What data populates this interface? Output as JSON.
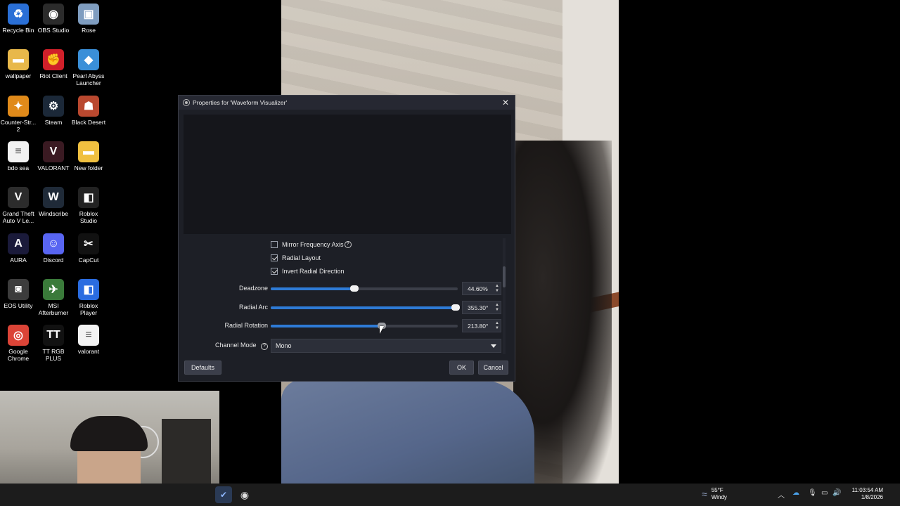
{
  "desktop": {
    "icons": [
      {
        "label": "Recycle Bin",
        "icon": "recycle-bin-icon",
        "color": "#2a6fd6",
        "glyph": "♻"
      },
      {
        "label": "OBS Studio",
        "icon": "obs-icon",
        "color": "#2b2b2b",
        "glyph": "◉"
      },
      {
        "label": "Rose",
        "icon": "image-icon",
        "color": "#7f9dc0",
        "glyph": "▣"
      },
      {
        "label": "wallpaper",
        "icon": "folder-icon",
        "color": "#e8b84a",
        "glyph": "▬"
      },
      {
        "label": "Riot Client",
        "icon": "riot-icon",
        "color": "#d0202a",
        "glyph": "✊"
      },
      {
        "label": "Pearl Abyss Launcher",
        "icon": "pearl-abyss-icon",
        "color": "#3a8fd8",
        "glyph": "◆"
      },
      {
        "label": "Counter-Str... 2",
        "icon": "counter-strike-icon",
        "color": "#e08a1a",
        "glyph": "✦"
      },
      {
        "label": "Steam",
        "icon": "steam-icon",
        "color": "#1b2838",
        "glyph": "⚙"
      },
      {
        "label": "Black Desert",
        "icon": "black-desert-icon",
        "color": "#b9482f",
        "glyph": "☗"
      },
      {
        "label": "bdo sea",
        "icon": "document-icon",
        "color": "#f2f2f2",
        "glyph": "≡"
      },
      {
        "label": "VALORANT",
        "icon": "valorant-icon",
        "color": "#3a1a22",
        "glyph": "V"
      },
      {
        "label": "New folder",
        "icon": "folder-icon",
        "color": "#f0c040",
        "glyph": "▬"
      },
      {
        "label": "Grand Theft Auto V Le...",
        "icon": "gta-icon",
        "color": "#2c2c2c",
        "glyph": "V"
      },
      {
        "label": "Windscribe",
        "icon": "windscribe-icon",
        "color": "#1f2a38",
        "glyph": "W"
      },
      {
        "label": "Roblox Studio",
        "icon": "roblox-studio-icon",
        "color": "#222222",
        "glyph": "◧"
      },
      {
        "label": "AURA",
        "icon": "aura-icon",
        "color": "#1a1a3a",
        "glyph": "A"
      },
      {
        "label": "Discord",
        "icon": "discord-icon",
        "color": "#5865f2",
        "glyph": "☺"
      },
      {
        "label": "CapCut",
        "icon": "capcut-icon",
        "color": "#111111",
        "glyph": "✂"
      },
      {
        "label": "EOS Utility",
        "icon": "camera-icon",
        "color": "#3c3c3c",
        "glyph": "◙"
      },
      {
        "label": "MSI Afterburner",
        "icon": "msi-icon",
        "color": "#3a7a3a",
        "glyph": "✈"
      },
      {
        "label": "Roblox Player",
        "icon": "roblox-icon",
        "color": "#2a6ce0",
        "glyph": "◧"
      },
      {
        "label": "Google Chrome",
        "icon": "chrome-icon",
        "color": "#db4437",
        "glyph": "◎"
      },
      {
        "label": "TT RGB PLUS",
        "icon": "tt-rgb-icon",
        "color": "#111111",
        "glyph": "TT"
      },
      {
        "label": "valorant",
        "icon": "document-icon",
        "color": "#f2f2f2",
        "glyph": "≡"
      }
    ]
  },
  "dialog": {
    "title": "Properties for 'Waveform Visualizer'",
    "checkboxes": [
      {
        "label": "Mirror Frequency Axis",
        "checked": false,
        "help": true
      },
      {
        "label": "Radial Layout",
        "checked": true,
        "help": false
      },
      {
        "label": "Invert Radial Direction",
        "checked": true,
        "help": false
      }
    ],
    "sliders": [
      {
        "label": "Deadzone",
        "value_text": "44.60%",
        "fraction": 0.446
      },
      {
        "label": "Radial Arc",
        "value_text": "355.30°",
        "fraction": 0.987
      },
      {
        "label": "Radial Rotation",
        "value_text": "213.80°",
        "fraction": 0.594
      }
    ],
    "channel_mode": {
      "label": "Channel Mode",
      "value": "Mono"
    },
    "buttons": {
      "defaults": "Defaults",
      "ok": "OK",
      "cancel": "Cancel"
    },
    "help_glyph": "?"
  },
  "taskbar": {
    "weather": {
      "temp": "55°F",
      "condition": "Windy"
    },
    "clock": {
      "time": "11:03:54 AM",
      "date": "1/8/2026"
    },
    "colors": {
      "accent": "#2e7bd6",
      "dialog_bg": "#1d1f26"
    }
  }
}
